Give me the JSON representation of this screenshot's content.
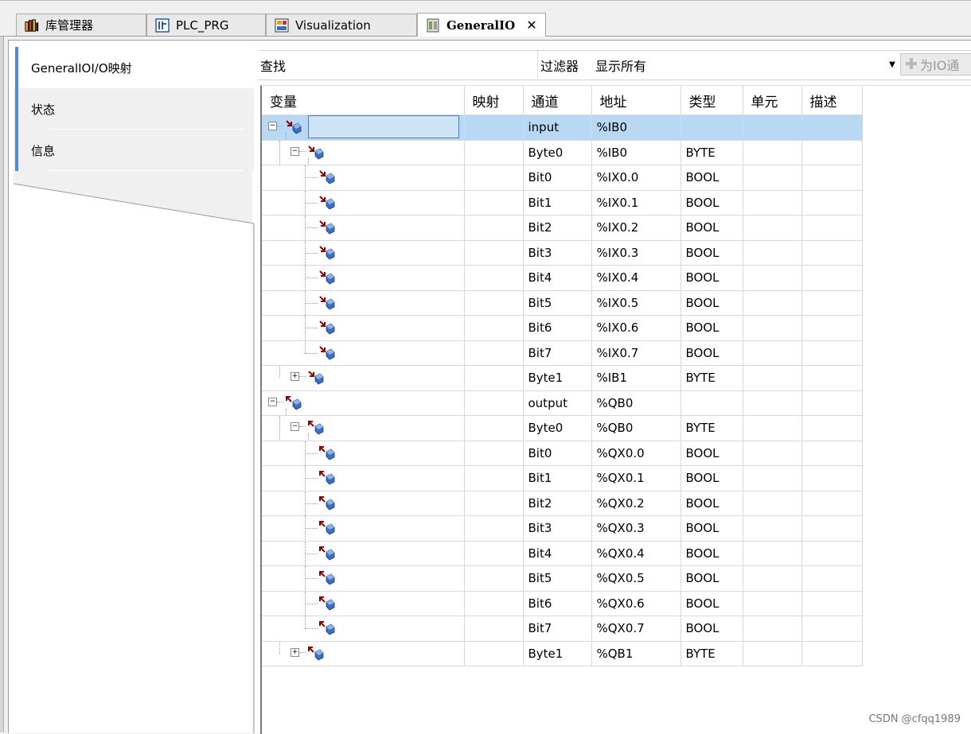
{
  "tabs": [
    {
      "label": "库管理器",
      "icon": "library-books-icon",
      "active": false
    },
    {
      "label": "PLC_PRG",
      "icon": "program-icon",
      "active": false
    },
    {
      "label": "Visualization",
      "icon": "visualization-icon",
      "active": false
    },
    {
      "label": "GeneralIO",
      "icon": "device-icon",
      "active": true,
      "close": "✕"
    }
  ],
  "side_tabs": [
    {
      "label": "GeneralIOI/O映射",
      "active": true
    },
    {
      "label": "状态",
      "active": false
    },
    {
      "label": "信息",
      "active": false
    }
  ],
  "toolbar": {
    "find_label": "查找",
    "filter_label": "过滤器",
    "filter_value": "显示所有",
    "add_button": "为IO通",
    "add_icon": "plus-icon"
  },
  "table": {
    "columns": [
      "变量",
      "映射",
      "通道",
      "地址",
      "类型",
      "单元",
      "描述"
    ],
    "rows": [
      {
        "level": 0,
        "dir": "in",
        "toggle": "minus",
        "channel": "input",
        "address": "%IB0",
        "type": "",
        "selected": true
      },
      {
        "level": 1,
        "dir": "in",
        "toggle": "minus",
        "channel": "Byte0",
        "address": "%IB0",
        "type": "BYTE"
      },
      {
        "level": 2,
        "dir": "in",
        "channel": "Bit0",
        "address": "%IX0.0",
        "type": "BOOL"
      },
      {
        "level": 2,
        "dir": "in",
        "channel": "Bit1",
        "address": "%IX0.1",
        "type": "BOOL"
      },
      {
        "level": 2,
        "dir": "in",
        "channel": "Bit2",
        "address": "%IX0.2",
        "type": "BOOL"
      },
      {
        "level": 2,
        "dir": "in",
        "channel": "Bit3",
        "address": "%IX0.3",
        "type": "BOOL"
      },
      {
        "level": 2,
        "dir": "in",
        "channel": "Bit4",
        "address": "%IX0.4",
        "type": "BOOL"
      },
      {
        "level": 2,
        "dir": "in",
        "channel": "Bit5",
        "address": "%IX0.5",
        "type": "BOOL"
      },
      {
        "level": 2,
        "dir": "in",
        "channel": "Bit6",
        "address": "%IX0.6",
        "type": "BOOL"
      },
      {
        "level": 2,
        "dir": "in",
        "channel": "Bit7",
        "address": "%IX0.7",
        "type": "BOOL",
        "last": true
      },
      {
        "level": 1,
        "dir": "in",
        "toggle": "plus",
        "channel": "Byte1",
        "address": "%IB1",
        "type": "BYTE",
        "last": true
      },
      {
        "level": 0,
        "dir": "out",
        "toggle": "minus",
        "channel": "output",
        "address": "%QB0",
        "type": ""
      },
      {
        "level": 1,
        "dir": "out",
        "toggle": "minus",
        "channel": "Byte0",
        "address": "%QB0",
        "type": "BYTE"
      },
      {
        "level": 2,
        "dir": "out",
        "channel": "Bit0",
        "address": "%QX0.0",
        "type": "BOOL"
      },
      {
        "level": 2,
        "dir": "out",
        "channel": "Bit1",
        "address": "%QX0.1",
        "type": "BOOL"
      },
      {
        "level": 2,
        "dir": "out",
        "channel": "Bit2",
        "address": "%QX0.2",
        "type": "BOOL"
      },
      {
        "level": 2,
        "dir": "out",
        "channel": "Bit3",
        "address": "%QX0.3",
        "type": "BOOL"
      },
      {
        "level": 2,
        "dir": "out",
        "channel": "Bit4",
        "address": "%QX0.4",
        "type": "BOOL"
      },
      {
        "level": 2,
        "dir": "out",
        "channel": "Bit5",
        "address": "%QX0.5",
        "type": "BOOL"
      },
      {
        "level": 2,
        "dir": "out",
        "channel": "Bit6",
        "address": "%QX0.6",
        "type": "BOOL"
      },
      {
        "level": 2,
        "dir": "out",
        "channel": "Bit7",
        "address": "%QX0.7",
        "type": "BOOL",
        "last": true
      },
      {
        "level": 1,
        "dir": "out",
        "toggle": "plus",
        "channel": "Byte1",
        "address": "%QB1",
        "type": "BYTE",
        "last": true
      }
    ]
  },
  "watermark": "CSDN @cfqq1989"
}
